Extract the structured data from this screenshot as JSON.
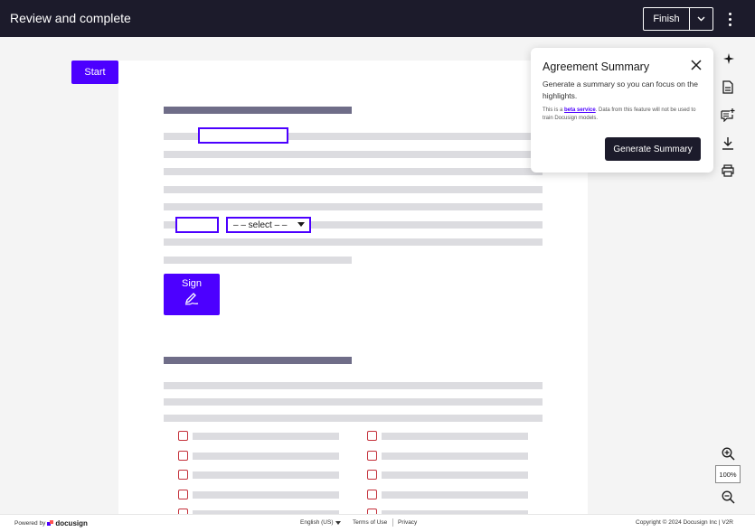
{
  "header": {
    "title": "Review and complete",
    "finish_label": "Finish",
    "dropdown_icon": "chevron-down-icon",
    "more_icon": "kebab-menu-icon"
  },
  "document": {
    "start_label": "Start",
    "select_placeholder": "– – select – –",
    "sign_label": "Sign"
  },
  "summary_popup": {
    "title": "Agreement Summary",
    "description": "Generate a summary so you can focus on the highlights.",
    "note_prefix": "This is a ",
    "note_link": "beta service",
    "note_suffix": ". Data from this feature will not be used to train Docusign models.",
    "button_label": "Generate Summary"
  },
  "toolbar_icons": [
    "sparkle-icon",
    "document-icon",
    "comment-add-icon",
    "download-icon",
    "print-icon"
  ],
  "zoom": {
    "level": "100%"
  },
  "footer": {
    "powered_by": "Powered by",
    "brand": "docusign",
    "language": "English (US)",
    "terms": "Terms of Use",
    "privacy": "Privacy",
    "copyright": "Copyright © 2024 Docusign Inc | V2R"
  },
  "colors": {
    "accent": "#4c00ff",
    "header_bg": "#1c1b2b",
    "checkbox_border": "#c4303a"
  }
}
